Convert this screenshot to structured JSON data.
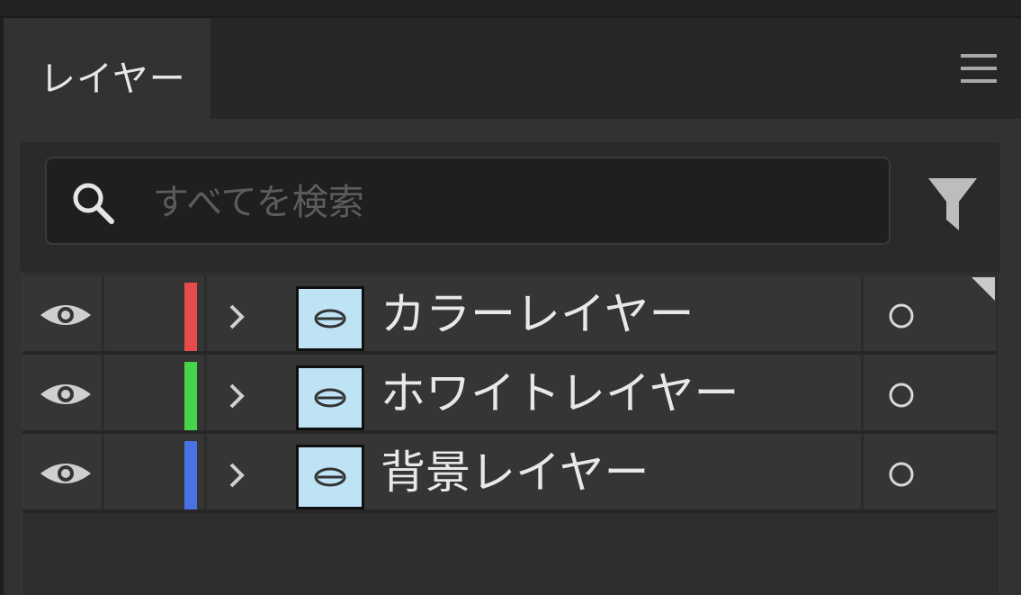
{
  "panel": {
    "tab_label": "レイヤー",
    "menu_icon": "hamburger-menu-icon"
  },
  "search": {
    "placeholder": "すべてを検索",
    "value": "",
    "search_icon": "search-icon",
    "filter_icon": "filter-icon"
  },
  "layers": [
    {
      "name": "カラーレイヤー",
      "color": "#e84b4b",
      "visible": true
    },
    {
      "name": "ホワイトレイヤー",
      "color": "#45d44a",
      "visible": true
    },
    {
      "name": "背景レイヤー",
      "color": "#4a72e4",
      "visible": true
    }
  ],
  "colors": {
    "thumbnail_bg": "#bde3f5",
    "panel_bg": "#323232",
    "text": "#e8e8e8"
  }
}
